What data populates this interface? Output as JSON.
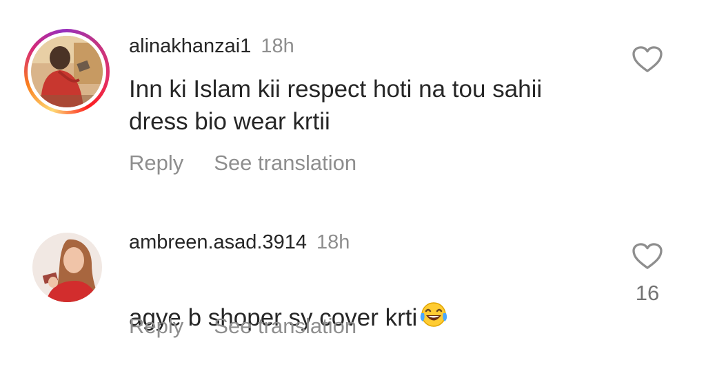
{
  "comments": [
    {
      "username": "alinakhanzai1",
      "time": "18h",
      "text": "Inn ki Islam kii respect hoti na tou sahii\ndress bio wear krtii",
      "reply_label": "Reply",
      "translate_label": "See translation",
      "has_story": true,
      "likes": ""
    },
    {
      "username": "ambreen.asad.3914",
      "time": "18h",
      "text": "agye b shoper sy cover krti",
      "emoji": "laughing-tears",
      "reply_label": "Reply",
      "translate_label": "See translation",
      "has_story": false,
      "likes": "16"
    }
  ],
  "colors": {
    "primary_text": "#262626",
    "secondary_text": "#8e8e8e",
    "heart_outline": "#8e8e8e"
  }
}
